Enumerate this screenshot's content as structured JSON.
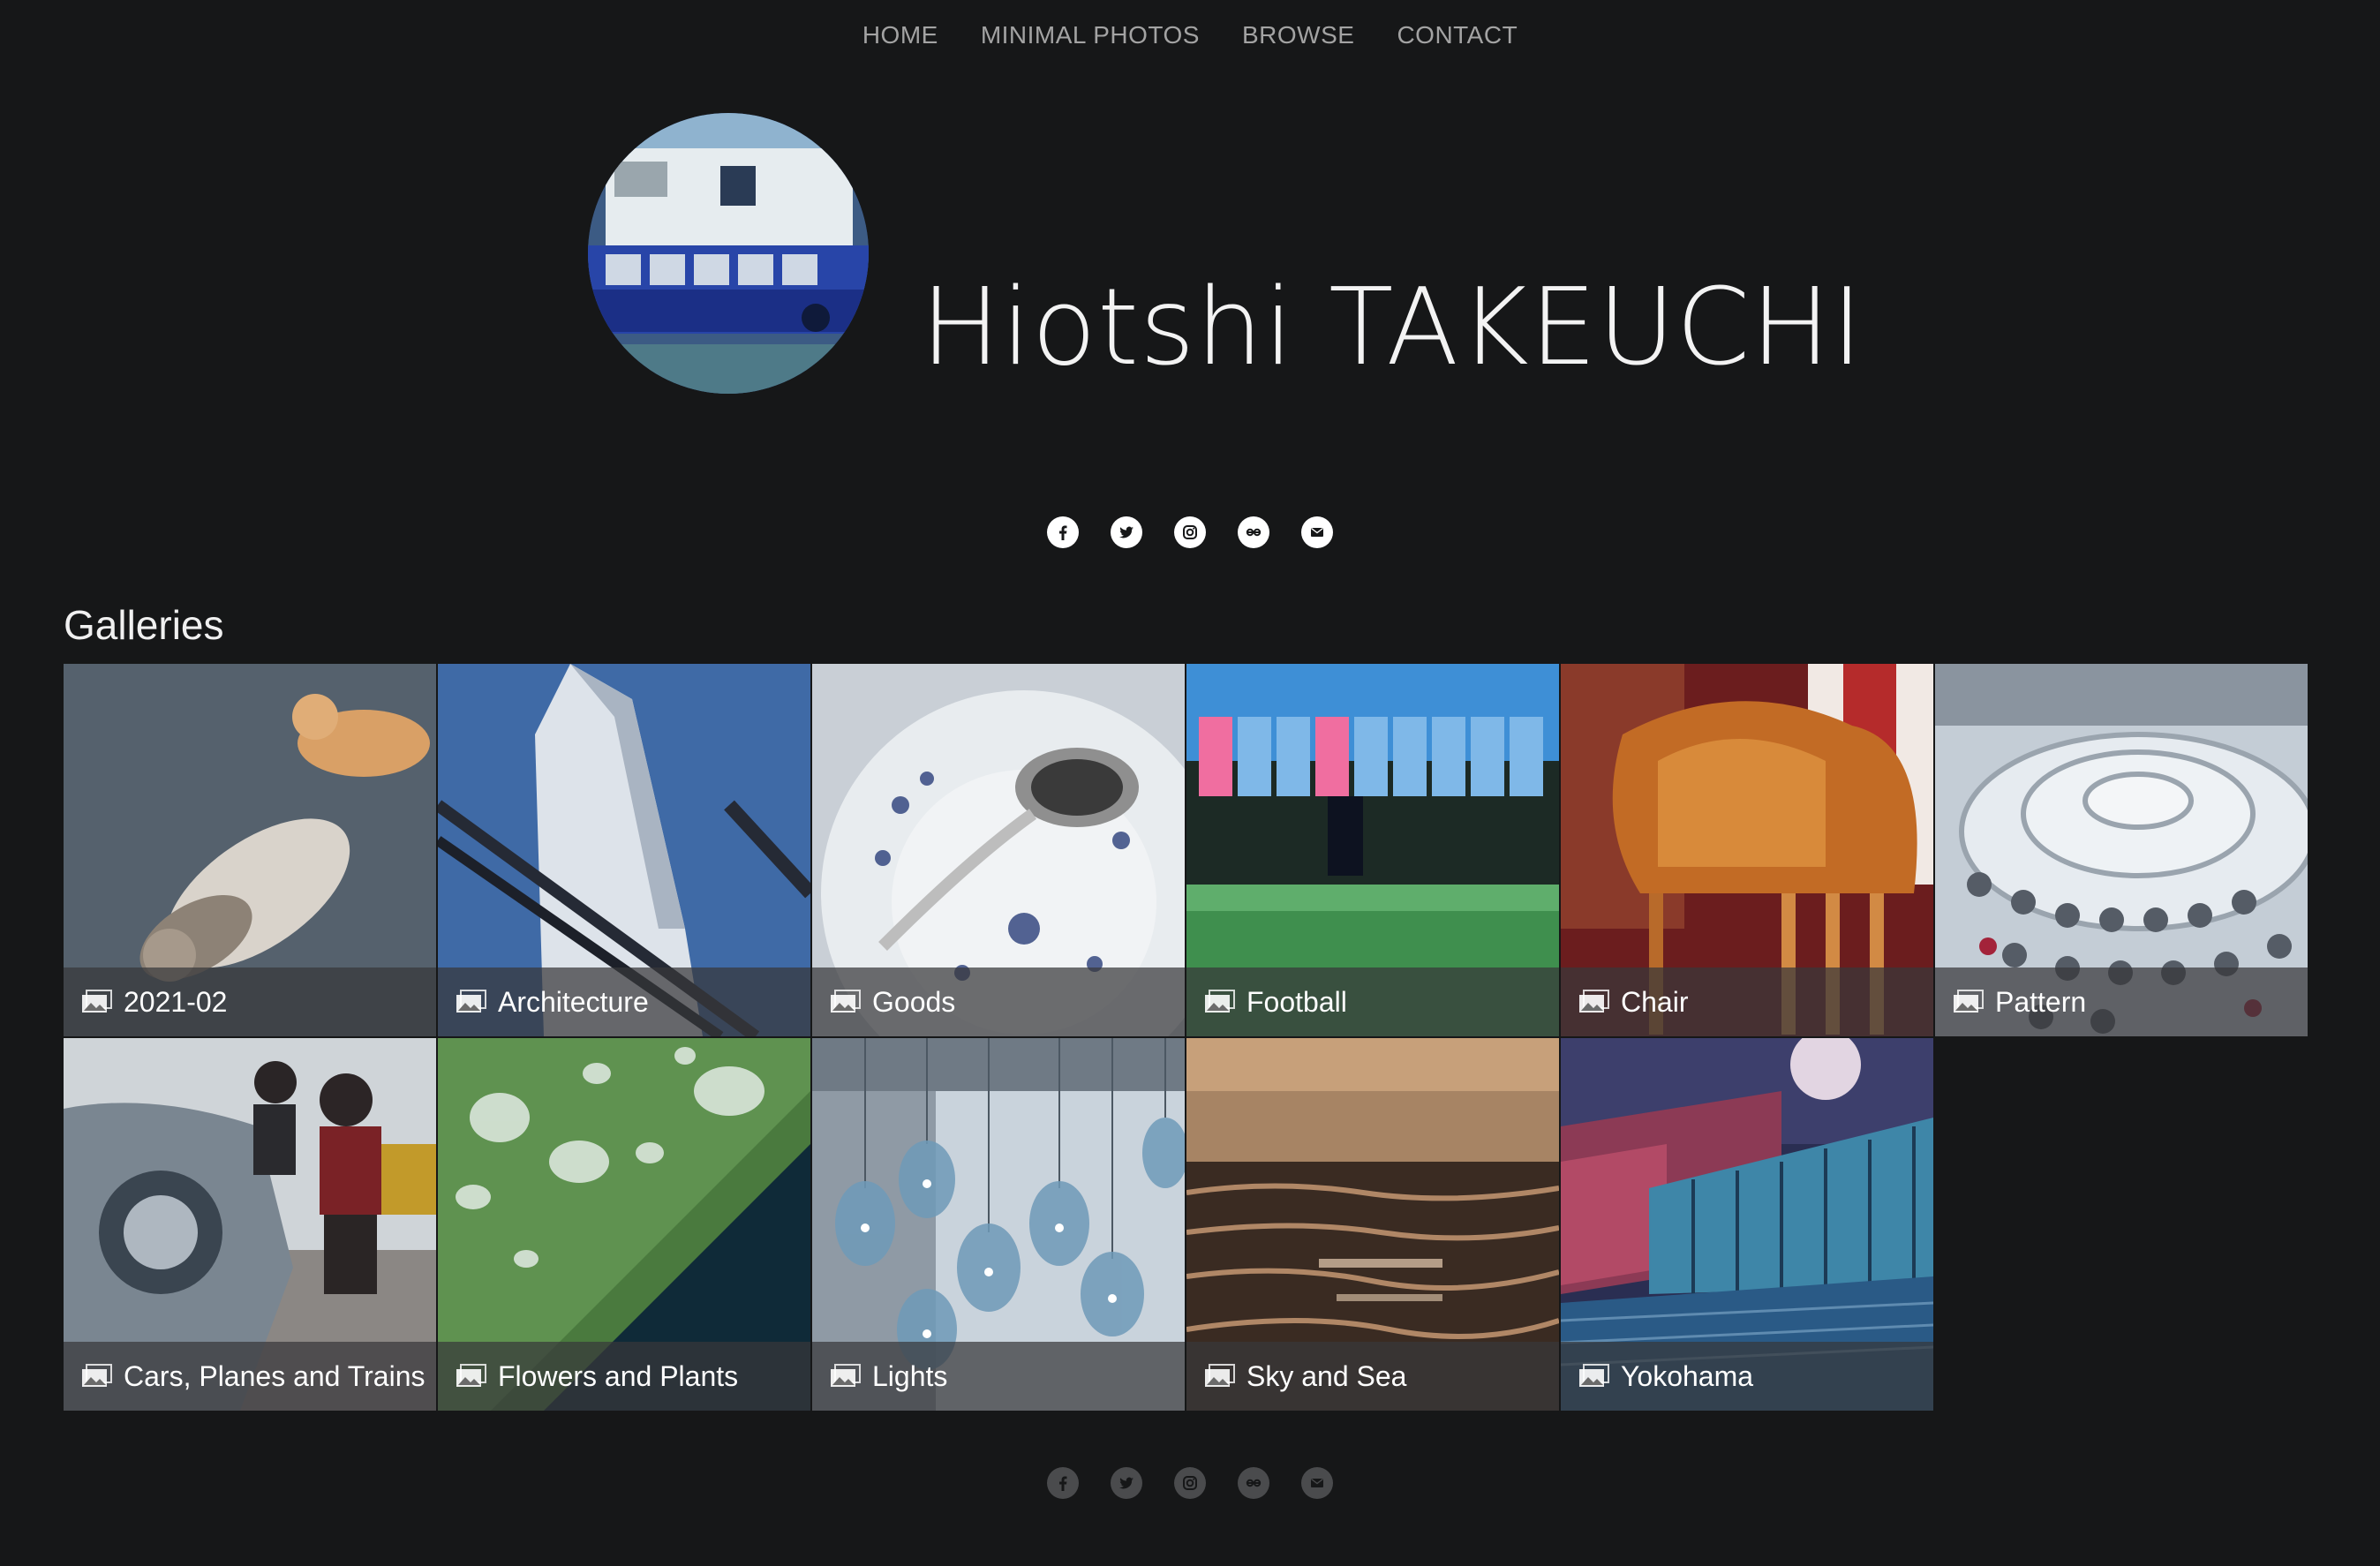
{
  "nav": {
    "items": [
      {
        "label": "HOME"
      },
      {
        "label": "MINIMAL PHOTOS"
      },
      {
        "label": "BROWSE"
      },
      {
        "label": "CONTACT"
      }
    ]
  },
  "header": {
    "title": "Hiotshi TAKEUCHI"
  },
  "social": {
    "icons": [
      "facebook-icon",
      "twitter-icon",
      "instagram-icon",
      "flickr-icon",
      "email-icon"
    ]
  },
  "galleries": {
    "heading": "Galleries",
    "items": [
      {
        "label": "2021-02",
        "icon": "gallery-icon"
      },
      {
        "label": "Architecture",
        "icon": "gallery-icon"
      },
      {
        "label": "Goods",
        "icon": "gallery-icon"
      },
      {
        "label": "Football",
        "icon": "gallery-icon"
      },
      {
        "label": "Chair",
        "icon": "gallery-icon"
      },
      {
        "label": "Pattern",
        "icon": "gallery-icon"
      },
      {
        "label": "Cars, Planes and Trains",
        "icon": "gallery-icon"
      },
      {
        "label": "Flowers and Plants",
        "icon": "gallery-icon"
      },
      {
        "label": "Lights",
        "icon": "gallery-icon"
      },
      {
        "label": "Sky and Sea",
        "icon": "gallery-icon"
      },
      {
        "label": "Yokohama",
        "icon": "gallery-icon"
      }
    ]
  },
  "colors": {
    "background": "#161718",
    "nav_text": "#a3a3a3",
    "caption_bg": "rgba(55,56,58,0.72)"
  }
}
